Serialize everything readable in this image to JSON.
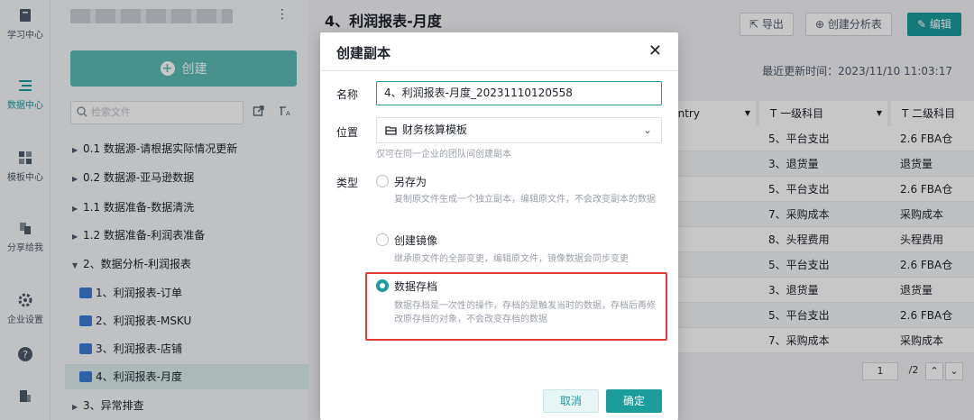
{
  "rail": {
    "items": [
      {
        "label": "学习中心",
        "icon": "book-icon"
      },
      {
        "label": "数据中心",
        "icon": "data-center-icon"
      },
      {
        "label": "模板中心",
        "icon": "template-icon"
      },
      {
        "label": "分享给我",
        "icon": "share-icon"
      },
      {
        "label": "企业设置",
        "icon": "settings-icon"
      }
    ]
  },
  "filepanel": {
    "more": "⋮",
    "create_label": "创建",
    "search_placeholder": "检索文件",
    "tree": [
      {
        "label": "0.1 数据源-请根据实际情况更新",
        "caret": "▶"
      },
      {
        "label": "0.2 数据源-亚马逊数据",
        "caret": "▶"
      },
      {
        "label": "1.1 数据准备-数据清洗",
        "caret": "▶"
      },
      {
        "label": "1.2 数据准备-利润表准备",
        "caret": "▶"
      },
      {
        "label": "2、数据分析-利润报表",
        "caret": "▼"
      },
      {
        "label": "1、利润报表-订单"
      },
      {
        "label": "2、利润报表-MSKU"
      },
      {
        "label": "3、利润报表-店铺"
      },
      {
        "label": "4、利润报表-月度"
      },
      {
        "label": "3、异常排查",
        "caret": "▶"
      }
    ]
  },
  "main": {
    "title": "4、利润报表-月度",
    "export_label": "导出",
    "create_analysis_label": "创建分析表",
    "edit_label": "编辑",
    "updated": "最近更新时间：2023/11/10 11:03:17",
    "grid": {
      "headers": [
        "untry",
        "T 一级科目",
        "T 二级科目"
      ],
      "rows": [
        [
          "5、平台支出",
          "2.6 FBA仓"
        ],
        [
          "3、退货量",
          "退货量"
        ],
        [
          "5、平台支出",
          "2.6 FBA仓"
        ],
        [
          "7、采购成本",
          "采购成本"
        ],
        [
          "8、头程费用",
          "头程费用"
        ],
        [
          "5、平台支出",
          "2.6 FBA仓"
        ],
        [
          "3、退货量",
          "退货量"
        ],
        [
          "5、平台支出",
          "2.6 FBA仓"
        ],
        [
          "7、采购成本",
          "采购成本"
        ]
      ]
    },
    "pager": {
      "page": "1",
      "total": "/2"
    }
  },
  "dialog": {
    "title": "创建副本",
    "name_label": "名称",
    "name_value": "4、利润报表-月度_20231110120558",
    "location_label": "位置",
    "location_value": "财务核算模板",
    "location_hint": "仅可在同一企业的团队间创建副本",
    "type_label": "类型",
    "options": [
      {
        "label": "另存为",
        "desc": "复制原文件生成一个独立副本，编辑原文件，不会改变副本的数据",
        "checked": false
      },
      {
        "label": "创建镜像",
        "desc": "继承原文件的全部变更，编辑原文件，镜像数据会同步变更",
        "checked": false
      },
      {
        "label": "数据存档",
        "desc": "数据存档是一次性的操作，存档的是触发当时的数据，存档后再修改原存档的对象，不会改变存档的数据",
        "checked": true
      }
    ],
    "cancel_label": "取消",
    "ok_label": "确定"
  }
}
